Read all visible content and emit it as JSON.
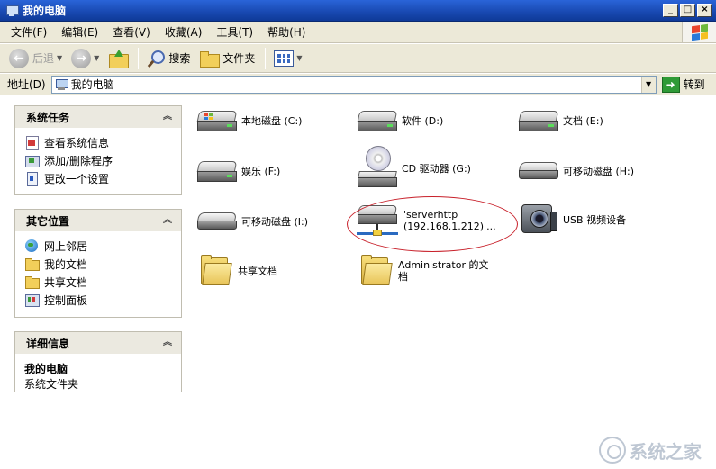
{
  "window": {
    "title": "我的电脑",
    "min_glyph": "_",
    "max_glyph": "□",
    "close_glyph": "×"
  },
  "menu": [
    "文件(F)",
    "编辑(E)",
    "查看(V)",
    "收藏(A)",
    "工具(T)",
    "帮助(H)"
  ],
  "toolbar": {
    "back_label": "后退",
    "search_label": "搜索",
    "folders_label": "文件夹"
  },
  "address": {
    "label": "地址(D)",
    "value": "我的电脑",
    "go_label": "转到"
  },
  "panels": {
    "system_tasks": {
      "title": "系统任务",
      "items": [
        "查看系统信息",
        "添加/删除程序",
        "更改一个设置"
      ]
    },
    "other_places": {
      "title": "其它位置",
      "items": [
        "网上邻居",
        "我的文档",
        "共享文档",
        "控制面板"
      ]
    },
    "details": {
      "title": "详细信息",
      "name": "我的电脑",
      "type": "系统文件夹"
    }
  },
  "items": [
    {
      "label": "本地磁盘 (C:)",
      "icon": "hdd-icon"
    },
    {
      "label": "软件 (D:)",
      "icon": "hdd-icon"
    },
    {
      "label": "文档 (E:)",
      "icon": "hdd-icon"
    },
    {
      "label": "娱乐 (F:)",
      "icon": "hdd-icon"
    },
    {
      "label": "CD 驱动器 (G:)",
      "icon": "cd-drive-icon"
    },
    {
      "label": "可移动磁盘 (H:)",
      "icon": "removable-disk-icon"
    },
    {
      "label": "可移动磁盘 (I:)",
      "icon": "removable-disk-icon"
    },
    {
      "label_line1": "'serverhttp",
      "label_line2": "(192.168.1.212)'...",
      "icon": "network-drive-icon"
    },
    {
      "label": "USB 视频设备",
      "icon": "usb-camera-icon"
    },
    {
      "label": "共享文档",
      "icon": "folder-icon"
    },
    {
      "label_line1": "Administrator 的文",
      "label_line2": "档",
      "icon": "folder-icon"
    }
  ],
  "watermark": {
    "text": "系统之家"
  }
}
